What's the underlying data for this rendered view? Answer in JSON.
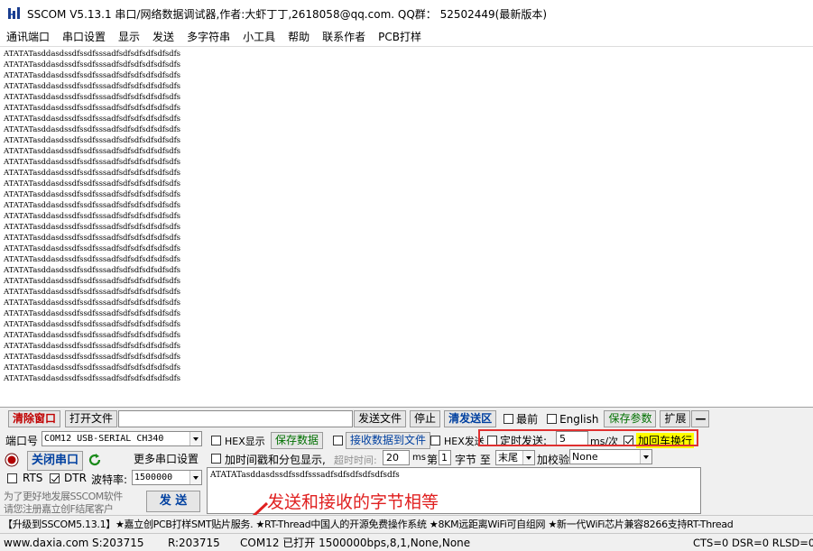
{
  "window": {
    "title": "SSCOM V5.13.1 串口/网络数据调试器,作者:大虾丁丁,2618058@qq.com. QQ群： 52502449(最新版本)"
  },
  "menu": [
    "通讯端口",
    "串口设置",
    "显示",
    "发送",
    "多字符串",
    "小工具",
    "帮助",
    "联系作者",
    "PCB打样"
  ],
  "output": {
    "line": "ATATATasddasdssdfssdfsssadfsdfsdfsdfsdfsdfs",
    "line_count": 31
  },
  "toolbar": {
    "clear_window": "清除窗口",
    "open_file": "打开文件",
    "file_path": "",
    "send_file": "发送文件",
    "stop": "停止",
    "clear_send": "清发送区",
    "topmost": "最前",
    "english": "English",
    "save_params": "保存参数",
    "expand": "扩展",
    "collapse": "—"
  },
  "port": {
    "port_label": "端口号",
    "port_value": "COM12 USB-SERIAL CH340",
    "close_port": "关闭串口",
    "more_settings": "更多串口设置",
    "rts": "RTS",
    "dtr": "DTR",
    "baud_label": "波特率:",
    "baud_value": "1500000",
    "promo_line1": "为了更好地发展SSCOM软件",
    "promo_line2": "请您注册嘉立创F结尾客户",
    "send": "发 送"
  },
  "options": {
    "hex_display": "HEX显示",
    "save_data": "保存数据",
    "recv_to_file": "接收数据到文件",
    "hex_send": "HEX发送",
    "timed_send": "定时发送:",
    "interval_value": "5",
    "interval_unit": "ms/次",
    "add_crlf": "加回车换行",
    "timestamp": "加时间戳和分包显示,",
    "timeout_label": "超时时间:",
    "timeout_value": "20",
    "timeout_unit": "ms",
    "nth_label": "第",
    "nth_value": "1",
    "byte_label": "字节 至",
    "end_value": "末尾",
    "checksum_label": "加校验",
    "checksum_value": "None"
  },
  "send_text": "ATATATasddasdssdfssdfsssadfsdfsdfsdfsdfsdfs",
  "ticker": "【升级到SSCOM5.13.1】★嘉立创PCB打样SMT贴片服务. ★RT-Thread中国人的开源免费操作系统 ★8KM远距离WiFi可自组网 ★新一代WiFi芯片兼容8266支持RT-Thread",
  "status": {
    "website": "www.daxia.com",
    "sent": "S:203715",
    "received": "R:203715",
    "port_state": "COM12 已打开  1500000bps,8,1,None,None",
    "signals": "CTS=0 DSR=0 RLSD=0"
  },
  "annotation": "发送和接收的字节相等",
  "colors": {
    "highlight": "#e03030",
    "crlf_bg": "#ffff00"
  }
}
